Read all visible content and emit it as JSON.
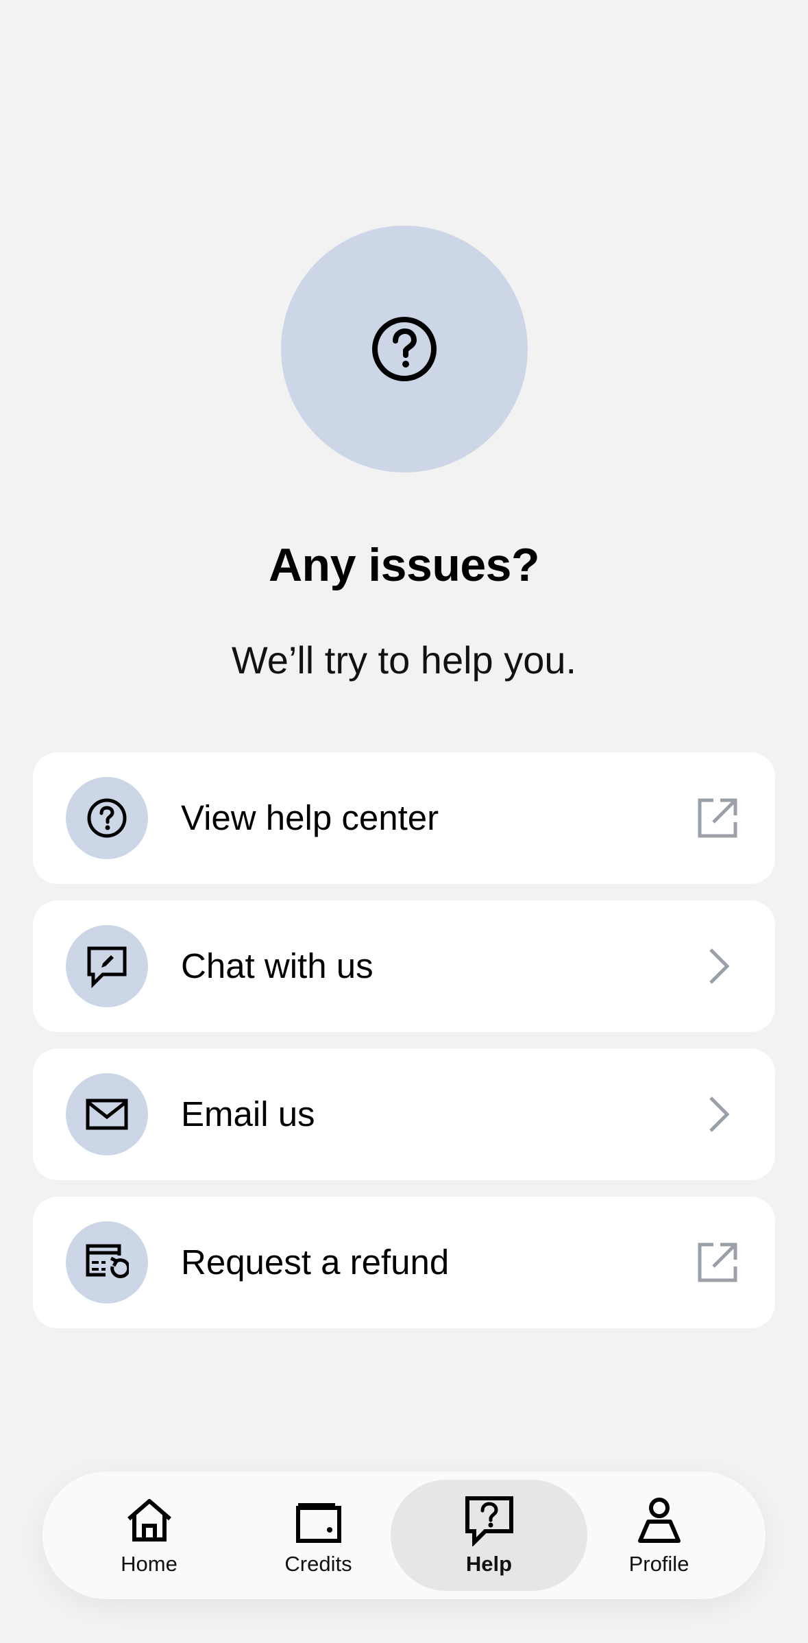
{
  "header": {
    "icon": "help-circle-icon",
    "title": "Any issues?",
    "subtitle": "We’ll try to help you."
  },
  "options": [
    {
      "label": "View help center",
      "icon": "help-circle-icon",
      "trailing": "external-link-icon"
    },
    {
      "label": "Chat with us",
      "icon": "chat-edit-icon",
      "trailing": "chevron-right-icon"
    },
    {
      "label": "Email us",
      "icon": "mail-icon",
      "trailing": "chevron-right-icon"
    },
    {
      "label": "Request a refund",
      "icon": "card-refund-icon",
      "trailing": "external-link-icon"
    }
  ],
  "nav": {
    "items": [
      {
        "label": "Home",
        "icon": "home-icon",
        "active": false
      },
      {
        "label": "Credits",
        "icon": "wallet-icon",
        "active": false
      },
      {
        "label": "Help",
        "icon": "help-chat-icon",
        "active": true
      },
      {
        "label": "Profile",
        "icon": "user-icon",
        "active": false
      }
    ]
  },
  "colors": {
    "background": "#f2f2f2",
    "accent_circle": "#cdd6e6",
    "card": "#ffffff",
    "active_nav": "#e6e6e6",
    "trailing_icon": "#9aa0a8"
  }
}
